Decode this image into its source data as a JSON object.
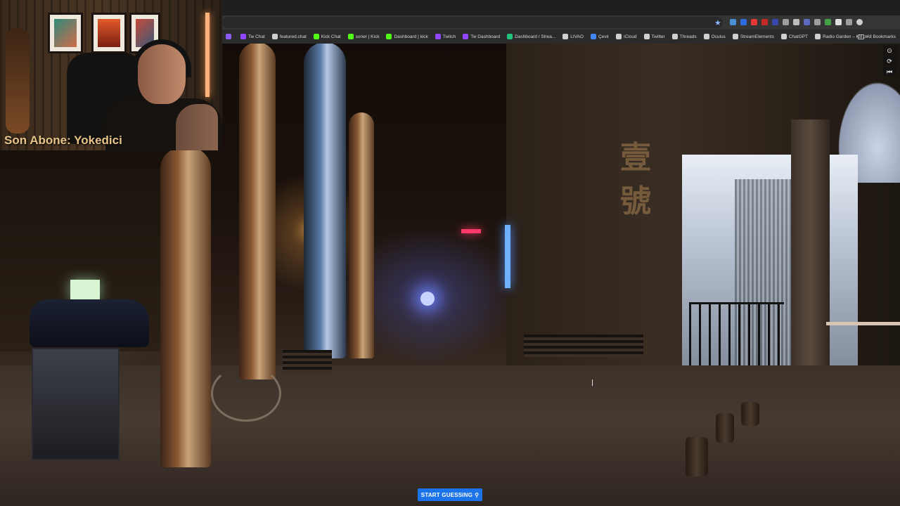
{
  "webcam": {
    "caption": "Son Abone: Yokedici"
  },
  "bookmarks": {
    "items": [
      {
        "label": "",
        "color": "#8b5cf6"
      },
      {
        "label": "Tw Chat",
        "color": "#9146ff"
      },
      {
        "label": "featured.chat",
        "color": "#cfcfcf"
      },
      {
        "label": "Kick Chat",
        "color": "#53fc18"
      },
      {
        "label": "soner | Kick",
        "color": "#53fc18"
      },
      {
        "label": "Dashboard | kick",
        "color": "#53fc18"
      },
      {
        "label": "Twitch",
        "color": "#9146ff"
      },
      {
        "label": "Tw Dashboard",
        "color": "#9146ff"
      },
      {
        "label": "Dashboard / Strea...",
        "color": "#21c47a"
      },
      {
        "label": "LIVAO",
        "color": "#cfcfcf"
      },
      {
        "label": "Çevir",
        "color": "#4285f4"
      },
      {
        "label": "iCloud",
        "color": "#cfcfcf"
      },
      {
        "label": "Twitter",
        "color": "#cfcfcf"
      },
      {
        "label": "Threads",
        "color": "#cfcfcf"
      },
      {
        "label": "Oculus",
        "color": "#cfcfcf"
      },
      {
        "label": "StreamElements",
        "color": "#cfcfcf"
      },
      {
        "label": "ChatGPT",
        "color": "#cfcfcf"
      },
      {
        "label": "Radio Garden – KB...",
        "color": "#cfcfcf"
      }
    ],
    "overflow": "»",
    "all_label": "All Bookmarks"
  },
  "street_sign": {
    "glyphs": [
      "壹",
      "號"
    ]
  },
  "side_controls": {
    "compass": "⊙",
    "refresh": "⟳",
    "undo": "⏮"
  },
  "game": {
    "start_label": "START GUESSING",
    "pin_icon": "⚲"
  },
  "colors": {
    "accent": "#1a73e8",
    "caption": "#e8c488"
  }
}
